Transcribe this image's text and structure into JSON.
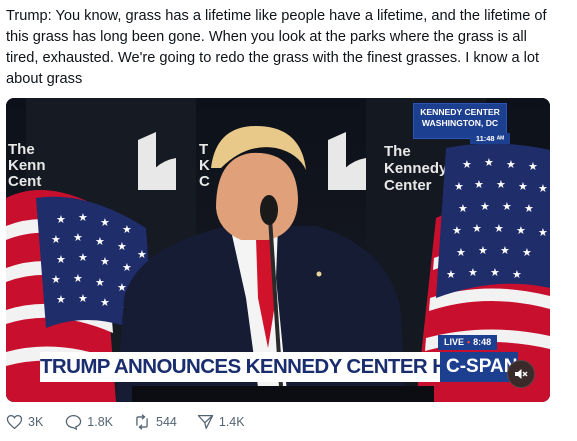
{
  "post": {
    "text": "Trump: You know, grass has a lifetime like people have a lifetime, and the lifetime of this grass has long been gone. When you look at the parks where the grass is all tired, exhausted. We're going to redo the grass with the finest grasses. I know a lot about grass"
  },
  "video": {
    "location_line1": "KENNEDY CENTER",
    "location_line2": "WASHINGTON, DC",
    "clock": "11:48 ᴬᴹ",
    "live_label": "LIVE",
    "live_time": "8:48",
    "headline": "TRUMP ANNOUNCES KENNEDY CENTER HONOREES",
    "network": "C-SPAN",
    "backdrop_text": [
      "The",
      "Kennedy",
      "Center"
    ],
    "backdrop_left_text": [
      "The",
      "Kenn",
      "Cent"
    ],
    "backdrop_mid_text": [
      "T",
      "K",
      "C"
    ]
  },
  "actions": {
    "likes": "3K",
    "replies": "1.8K",
    "reposts": "544",
    "shares": "1.4K"
  },
  "colors": {
    "cspan_blue": "#1d3f8f",
    "text_gray": "#536471"
  }
}
